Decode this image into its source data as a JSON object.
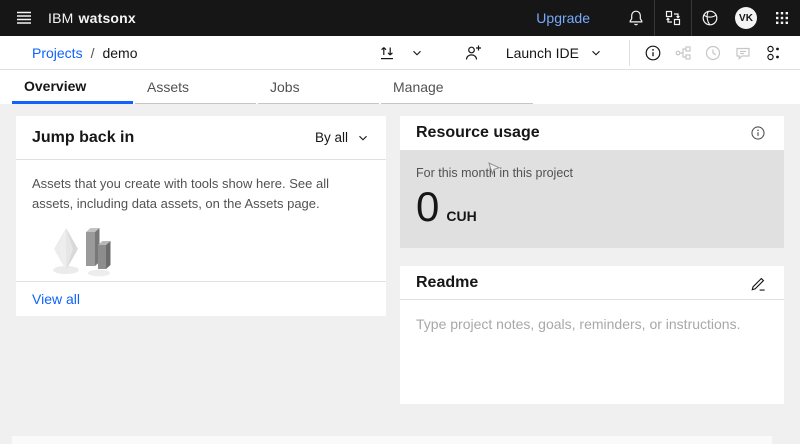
{
  "header": {
    "brand_prefix": "IBM",
    "brand_name": "watsonx",
    "upgrade_label": "Upgrade",
    "avatar_initials": "VK"
  },
  "toolbar": {
    "breadcrumb": {
      "root": "Projects",
      "separator": "/",
      "current": "demo"
    },
    "launch_ide_label": "Launch IDE"
  },
  "tabs": [
    {
      "label": "Overview",
      "active": true
    },
    {
      "label": "Assets",
      "active": false
    },
    {
      "label": "Jobs",
      "active": false
    },
    {
      "label": "Manage",
      "active": false
    }
  ],
  "jump_back_in": {
    "title": "Jump back in",
    "filter_label": "By all",
    "description": "Assets that you create with tools show here. See all assets, including data assets, on the Assets page.",
    "view_all_label": "View all"
  },
  "resource_usage": {
    "title": "Resource usage",
    "period_label": "For this month in this project",
    "value": "0",
    "unit": "CUH"
  },
  "readme": {
    "title": "Readme",
    "placeholder": "Type project notes, goals, reminders, or instructions."
  },
  "icons": [
    "menu-icon",
    "bell-icon",
    "transfer-icon",
    "globe-icon",
    "app-switcher-icon",
    "import-icon",
    "chevron-down-icon",
    "add-user-icon",
    "info-icon",
    "flow-icon",
    "recent-icon",
    "comments-icon",
    "members-icon",
    "edit-pencil-icon",
    "assets-illustration",
    "mouse-cursor"
  ],
  "colors": {
    "header_bg": "#161616",
    "header_link_blue": "#78a9ff",
    "link_blue": "#0f62fe",
    "active_tab_underline": "#0f62fe",
    "page_bg": "#f0f0f0",
    "panel_gray": "#e0e0e0",
    "disabled_icon": "#c6c6c6"
  }
}
